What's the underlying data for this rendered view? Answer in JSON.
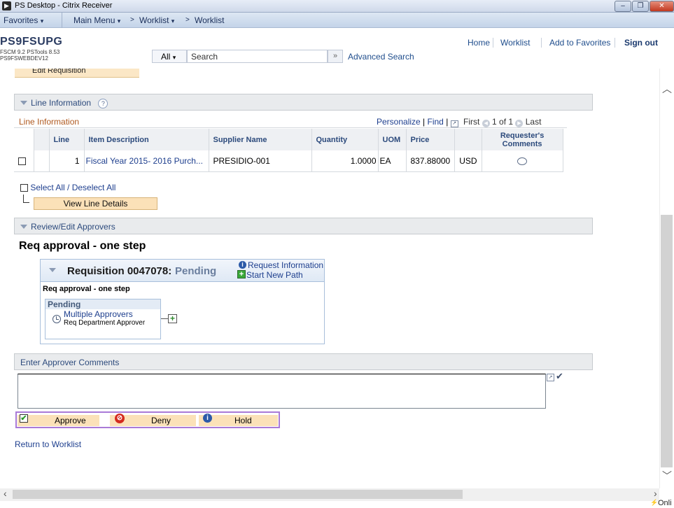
{
  "window": {
    "title": "PS Desktop - Citrix Receiver",
    "app_icon": "citrix-icon",
    "controls": {
      "minimize": "–",
      "maximize": "❐",
      "close": "✕"
    }
  },
  "nav": {
    "favorites": "Favorites",
    "main_menu": "Main Menu",
    "crumb1": "Worklist",
    "crumb2": "Worklist"
  },
  "branding": {
    "title": "PS9FSUPG",
    "line1": "FSCM 9.2  PSTools 8.53",
    "line2": "PS9FSWEBDEV12"
  },
  "top_links": {
    "home": "Home",
    "worklist": "Worklist",
    "add_favorites": "Add to Favorites",
    "sign_out": "Sign out"
  },
  "search": {
    "scope": "All",
    "placeholder": "Search",
    "go": "»",
    "advanced": "Advanced Search"
  },
  "edit_requisition_tab": "Edit Requisition",
  "line_info": {
    "section_title": "Line Information",
    "help": "?",
    "grid_title": "Line Information",
    "personalize": "Personalize",
    "find": "Find",
    "sep": "|",
    "first": "First",
    "count": "1 of 1",
    "last": "Last",
    "columns": [
      "Line",
      "Item Description",
      "Supplier Name",
      "Quantity",
      "UOM",
      "Price",
      "Requester's Comments"
    ],
    "rows": [
      {
        "line": "1",
        "item_description": "Fiscal Year 2015- 2016 Purch...",
        "supplier": "PRESIDIO-001",
        "quantity": "1.0000",
        "uom": "EA",
        "price": "837.88000",
        "currency": "USD"
      }
    ],
    "select_all": "Select All / Deselect All",
    "view_line_details": "View Line Details"
  },
  "approvers": {
    "section_title": "Review/Edit Approvers",
    "heading": "Req approval - one step",
    "requisition_label": "Requisition 0047078:",
    "status": "Pending",
    "request_info": "Request Information",
    "start_new_path": "Start New Path",
    "path_title": "Req approval - one step",
    "stage_status": "Pending",
    "approver_link": "Multiple Approvers",
    "approver_role": "Req Department Approver"
  },
  "comments": {
    "section_title": "Enter Approver Comments"
  },
  "actions": {
    "approve": "Approve",
    "deny": "Deny",
    "hold": "Hold"
  },
  "return_link": "Return to Worklist",
  "status_bar": {
    "online": "Onli"
  },
  "colors": {
    "link": "#1e3f8e",
    "pending": "#6a7e9e",
    "button_bg": "#fbe1b8",
    "action_border": "#a97ad7"
  }
}
